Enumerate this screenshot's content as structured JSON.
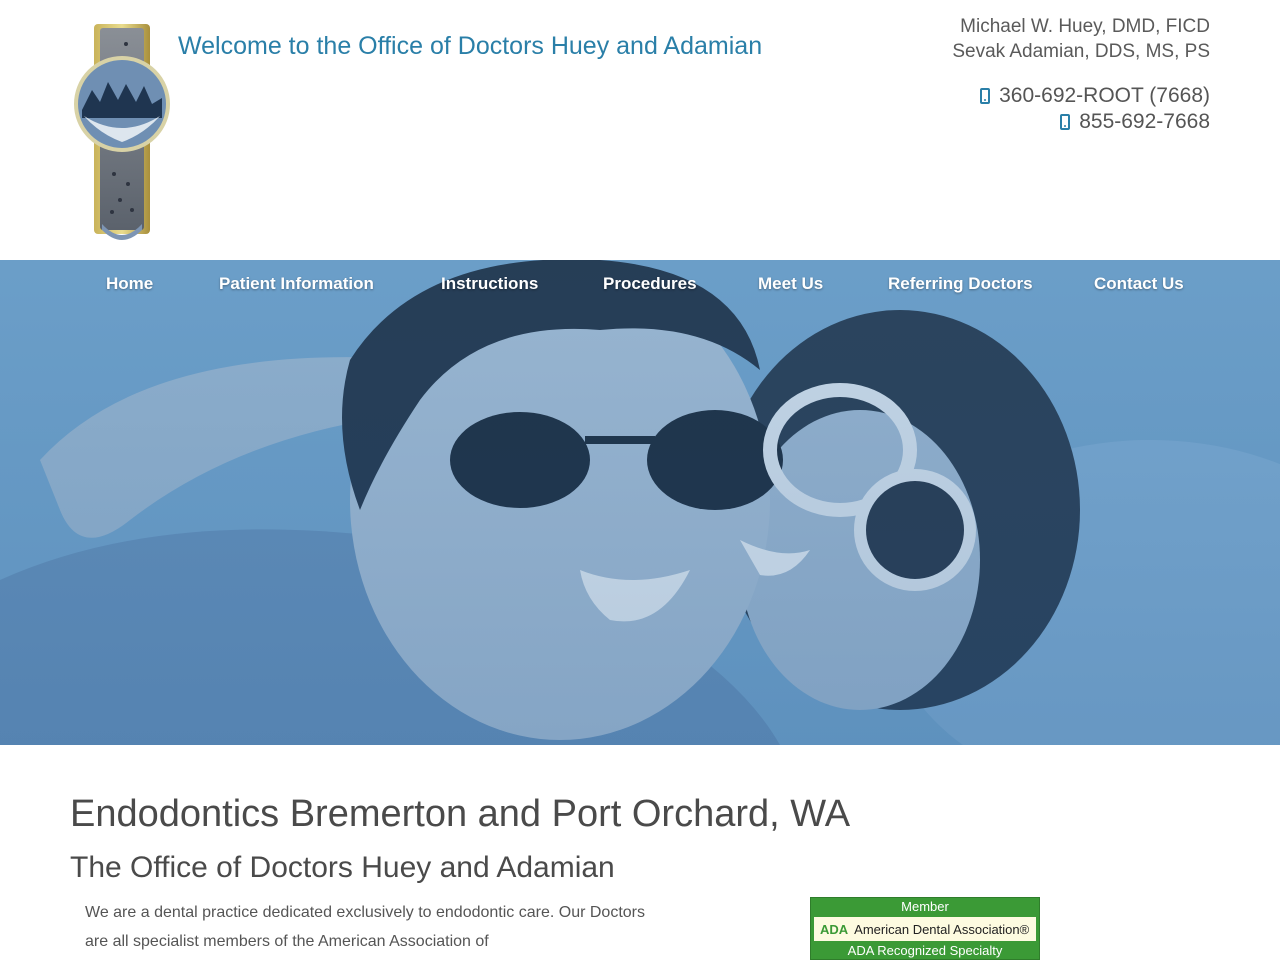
{
  "header": {
    "welcome": "Welcome to the Office of Doctors Huey and Adamian",
    "doctors": [
      "Michael W. Huey, DMD, FICD",
      "Sevak Adamian, DDS, MS, PS"
    ],
    "phones": [
      "360-692-ROOT (7668)",
      "855-692-7668"
    ],
    "logo_icon": "practice-logo-icon",
    "phone_icon": "mobile-phone-icon",
    "accent_color": "#2a7fa8"
  },
  "nav": {
    "items": [
      "Home",
      "Patient Information",
      "Instructions",
      "Procedures",
      "Meet Us",
      "Referring Doctors",
      "Contact Us"
    ]
  },
  "main": {
    "title": "Endodontics Bremerton and Port Orchard, WA",
    "subtitle": "The Office of Doctors Huey and Adamian",
    "intro": "We are a dental practice dedicated exclusively to endodontic care. Our Doctors are all specialist members of the American Association of"
  },
  "badge": {
    "member": "Member",
    "abbr": "ADA",
    "name": "American Dental Association®",
    "specialty": "ADA Recognized Specialty",
    "color": "#3b9a36"
  }
}
